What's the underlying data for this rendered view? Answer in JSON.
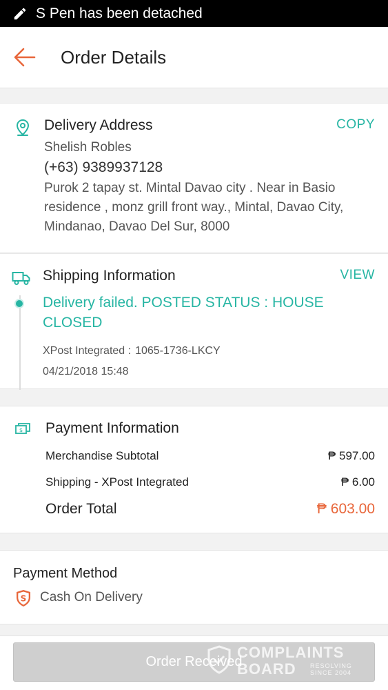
{
  "status_bar": {
    "message": "S Pen has been detached"
  },
  "header": {
    "title": "Order Details"
  },
  "delivery_address": {
    "heading": "Delivery Address",
    "copy_label": "COPY",
    "name": "Shelish Robles",
    "phone": "(+63) 9389937128",
    "address": "Purok 2 tapay st. Mintal Davao city . Near in Basio residence , monz grill front way., Mintal, Davao City, Mindanao, Davao Del Sur, 8000"
  },
  "shipping": {
    "heading": "Shipping Information",
    "view_label": "VIEW",
    "status": "Delivery failed. POSTED STATUS : HOUSE CLOSED",
    "carrier_label": "XPost Integrated :",
    "tracking": "1065-1736-LKCY",
    "datetime": "04/21/2018 15:48"
  },
  "payment_info": {
    "heading": "Payment Information",
    "rows": [
      {
        "label": "Merchandise Subtotal",
        "value": "₱ 597.00"
      },
      {
        "label": "Shipping - XPost Integrated",
        "value": "₱ 6.00"
      }
    ],
    "total_label": "Order Total",
    "total_value": "₱ 603.00"
  },
  "payment_method": {
    "heading": "Payment Method",
    "value": "Cash On Delivery"
  },
  "bottom_button": {
    "label": "Order Received"
  },
  "watermark": {
    "line1": "COMPLAINTS",
    "line2": "BOARD",
    "line3": "RESOLVING SINCE 2004"
  },
  "colors": {
    "accent": "#26b5a3",
    "price": "#e8663a",
    "button_disabled": "#cfcfcf"
  }
}
